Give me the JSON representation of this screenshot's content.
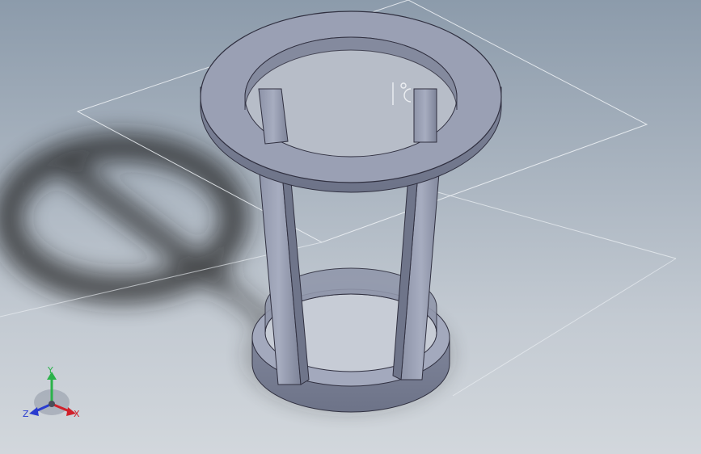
{
  "viewport": {
    "background_top": "#8c9bab",
    "background_bottom": "#d2d7dc"
  },
  "model": {
    "part_color": "#9aa0b4",
    "shadow_color": "#1e1e1e"
  },
  "triad": {
    "x_label": "X",
    "y_label": "Y",
    "z_label": "Z",
    "x_color": "#d0202a",
    "y_color": "#2bb24a",
    "z_color": "#2a3ccf"
  }
}
